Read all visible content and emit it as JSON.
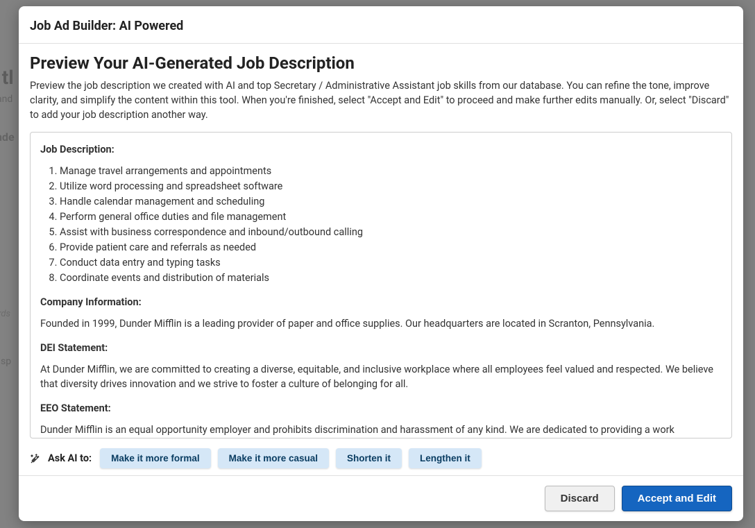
{
  "background": {
    "heading_fragment": "o tl",
    "line1_fragment": " and",
    "line2_fragment": "unde",
    "line3_fragment": "ords",
    "line4_fragment": "ot sp"
  },
  "modal": {
    "title": "Job Ad Builder: AI Powered",
    "preview_heading": "Preview Your AI-Generated Job Description",
    "preview_intro": "Preview the job description we created with AI and top Secretary / Administrative Assistant job skills from our database. You can refine the tone, improve clarity, and simplify the content within this tool. When you're finished, select \"Accept and Edit\" to proceed and make further edits manually. Or, select \"Discard\" to add your job description another way.",
    "sections": {
      "job_description": {
        "label": "Job Description:",
        "items": [
          "Manage travel arrangements and appointments",
          "Utilize word processing and spreadsheet software",
          "Handle calendar management and scheduling",
          "Perform general office duties and file management",
          "Assist with business correspondence and inbound/outbound calling",
          "Provide patient care and referrals as needed",
          "Conduct data entry and typing tasks",
          "Coordinate events and distribution of materials"
        ]
      },
      "company_info": {
        "label": "Company Information:",
        "text": "Founded in 1999, Dunder Mifflin is a leading provider of paper and office supplies. Our headquarters are located in Scranton, Pennsylvania."
      },
      "dei": {
        "label": "DEI Statement:",
        "text": "At Dunder Mifflin, we are committed to creating a diverse, equitable, and inclusive workplace where all employees feel valued and respected. We believe that diversity drives innovation and we strive to foster a culture of belonging for all."
      },
      "eeo": {
        "label": "EEO Statement:",
        "text": "Dunder Mifflin is an equal opportunity employer and prohibits discrimination and harassment of any kind. We are dedicated to providing a work"
      }
    },
    "ask_ai": {
      "label": "Ask AI to:",
      "options": {
        "formal": "Make it more formal",
        "casual": "Make it more casual",
        "shorten": "Shorten it",
        "lengthen": "Lengthen it"
      }
    },
    "footer": {
      "discard": "Discard",
      "accept": "Accept and Edit"
    }
  }
}
